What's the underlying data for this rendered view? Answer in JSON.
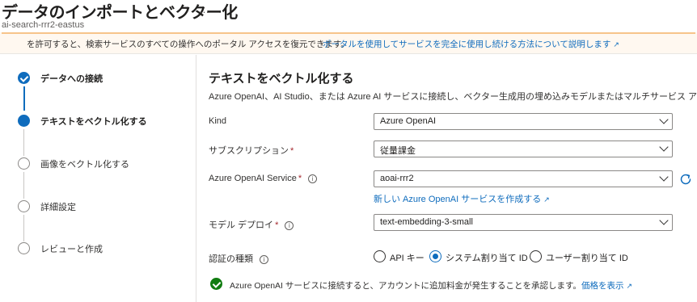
{
  "header": {
    "title": "データのインポートとベクター化",
    "ellipsis": "…",
    "subtitle": "ai-search-rrr2-eastus"
  },
  "banner": {
    "text": "を許可すると、検索サービスのすべての操作へのポータル アクセスを復元できます。",
    "link": "ポータルを使用してサービスを完全に使用し続ける方法について説明します"
  },
  "steps": [
    {
      "label": "データへの接続",
      "state": "done"
    },
    {
      "label": "テキストをベクトル化する",
      "state": "current"
    },
    {
      "label": "画像をベクトル化する",
      "state": "pending"
    },
    {
      "label": "詳細設定",
      "state": "pending"
    },
    {
      "label": "レビューと作成",
      "state": "pending"
    }
  ],
  "main": {
    "title": "テキストをベクトル化する",
    "description": "Azure OpenAI、AI Studio、または Azure AI サービスに接続し、ベクター生成用の埋め込みモデルまたはマルチサービス アカウン",
    "fields": {
      "kind": {
        "label": "Kind",
        "value": "Azure OpenAI"
      },
      "subscription": {
        "label": "サブスクリプション",
        "required": "*",
        "value": "従量課金"
      },
      "service": {
        "label": "Azure OpenAI Service",
        "required": "*",
        "info": "i",
        "value": "aoai-rrr2"
      },
      "deployment": {
        "label": "モデル デプロイ",
        "required": "*",
        "info": "i",
        "value": "text-embedding-3-small"
      },
      "auth": {
        "label": "認証の種類",
        "info": "i"
      }
    },
    "create_link": "新しい Azure OpenAI サービスを作成する",
    "auth_options": [
      {
        "label": "API キー",
        "selected": false
      },
      {
        "label": "システム割り当て ID",
        "selected": true
      },
      {
        "label": "ユーザー割り当て ID",
        "selected": false
      }
    ],
    "ack_text": "Azure OpenAI サービスに接続すると、アカウントに追加料金が発生することを承認します。",
    "ack_link": "価格を表示"
  },
  "colors": {
    "accent": "#0f6cbd",
    "success": "#107c10",
    "required": "#a4262c",
    "banner_bg": "#fff8f0"
  },
  "icons": {
    "external_link": "external-link-icon",
    "refresh": "refresh-icon",
    "info": "info-icon",
    "chevron": "chevron-down-icon",
    "check": "check-icon"
  }
}
